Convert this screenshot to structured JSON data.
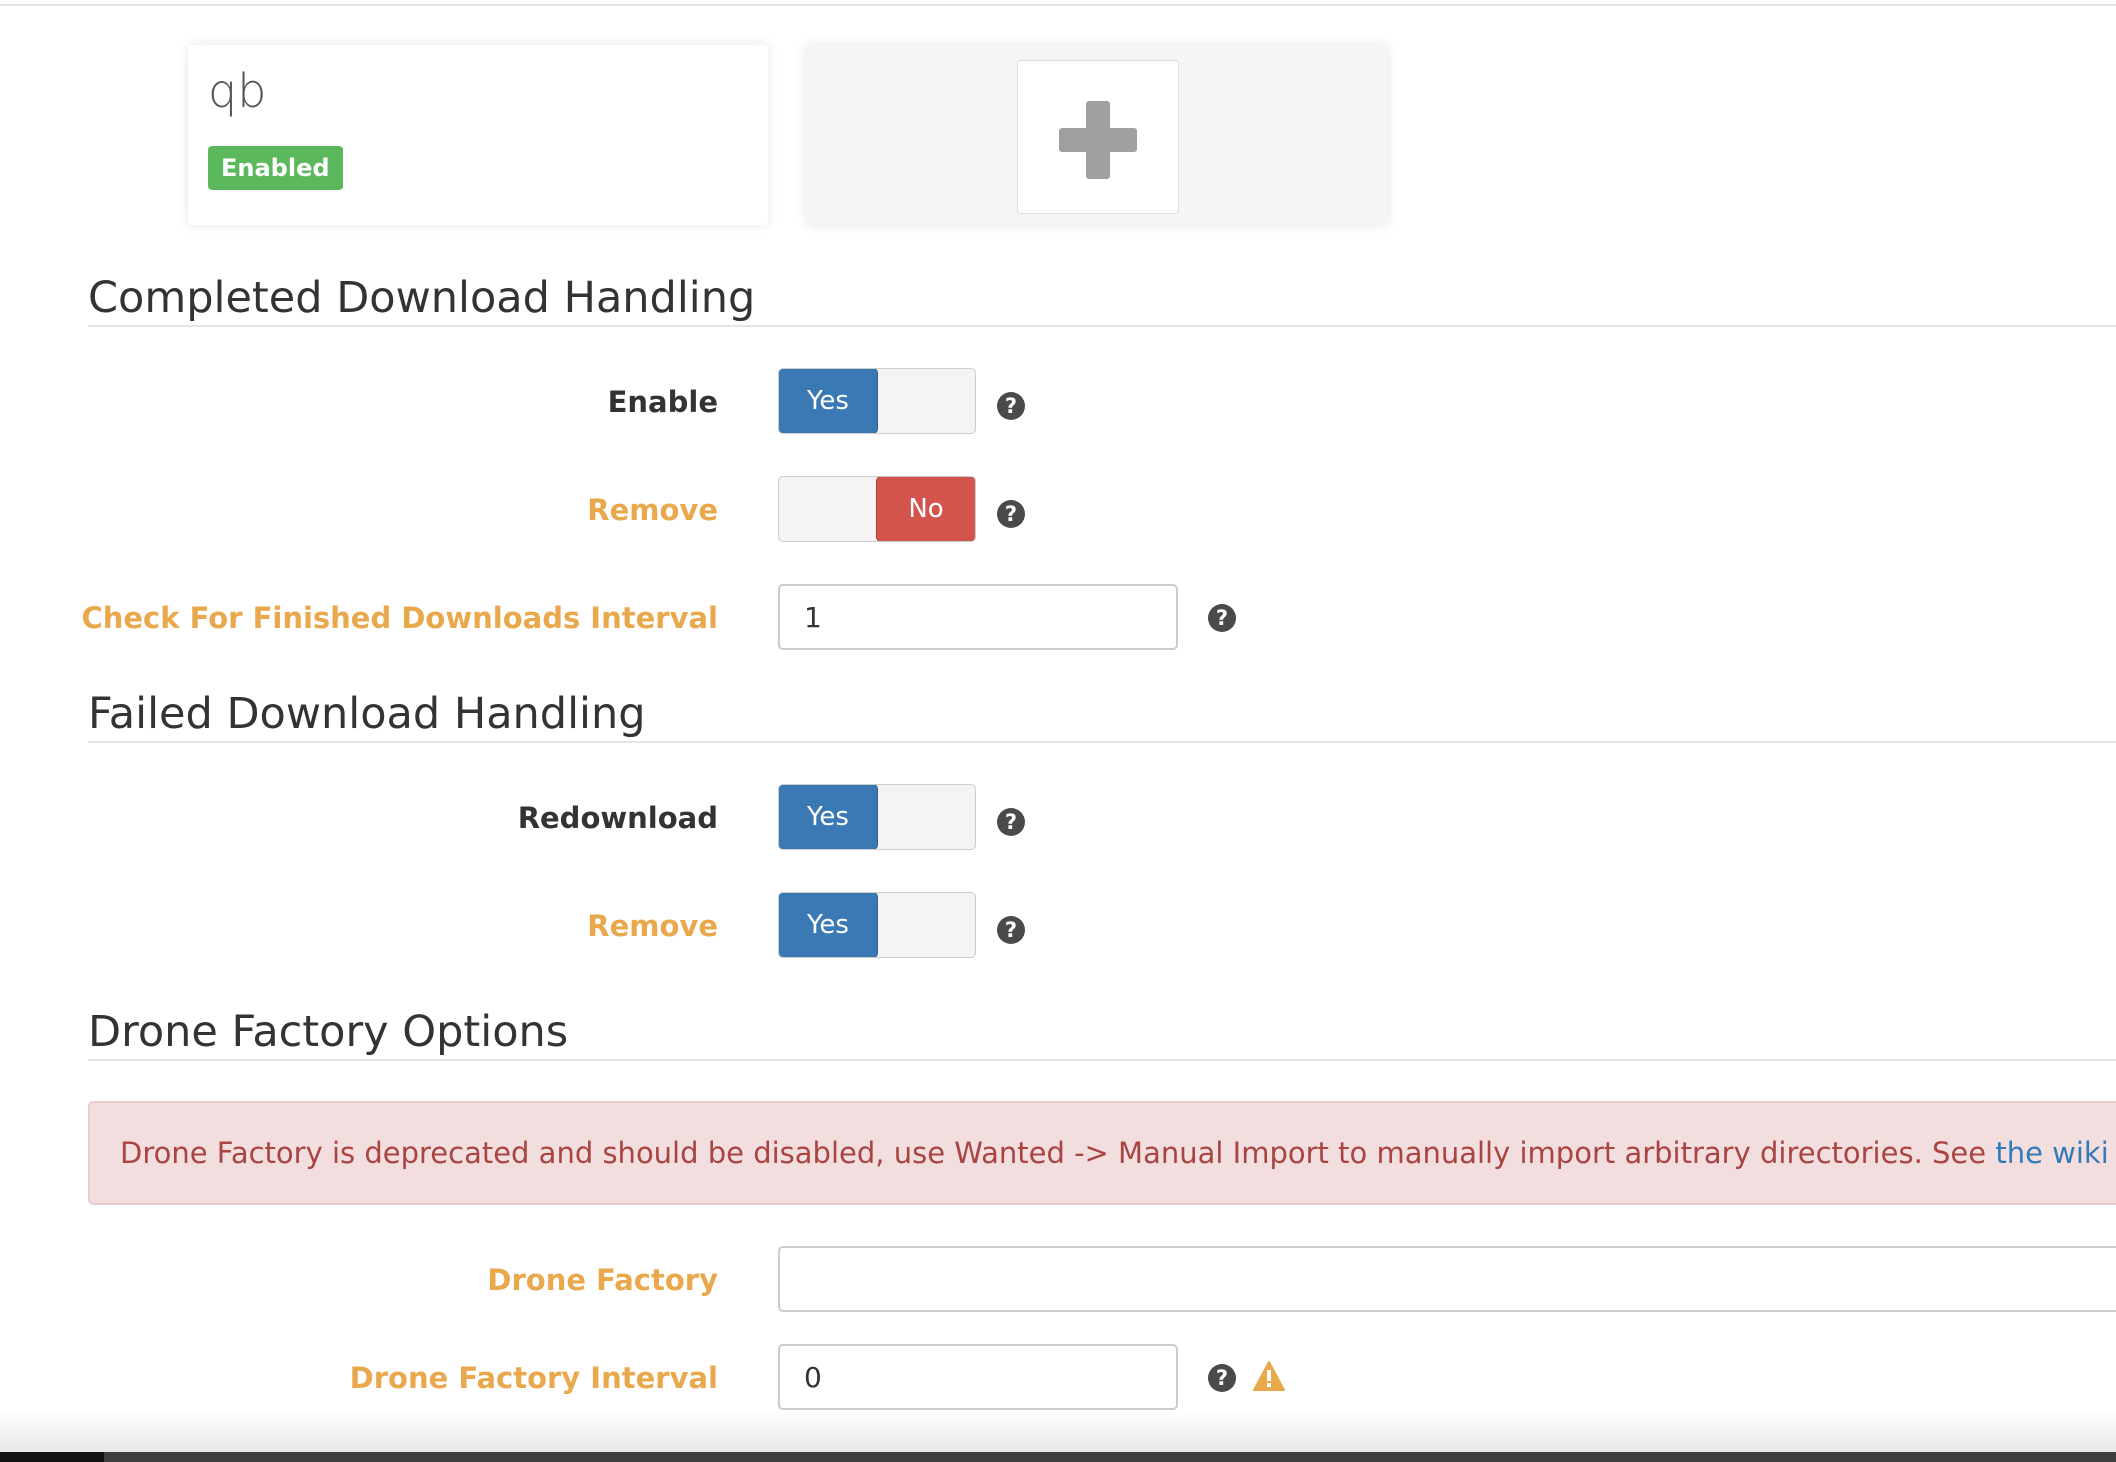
{
  "download_clients": {
    "client": {
      "name": "qb",
      "status": "Enabled"
    },
    "add_client_icon": "plus-icon"
  },
  "completed_download_handling": {
    "title": "Completed Download Handling",
    "enable": {
      "label": "Enable",
      "value": "Yes"
    },
    "remove": {
      "label": "Remove",
      "value": "No"
    },
    "check_interval": {
      "label": "Check For Finished Downloads Interval",
      "value": "1"
    }
  },
  "failed_download_handling": {
    "title": "Failed Download Handling",
    "redownload": {
      "label": "Redownload",
      "value": "Yes"
    },
    "remove": {
      "label": "Remove",
      "value": "Yes"
    }
  },
  "drone_factory_options": {
    "title": "Drone Factory Options",
    "alert": {
      "text": "Drone Factory is deprecated and should be disabled, use Wanted -> Manual Import to manually import arbitrary directories. See ",
      "link_text": "the wiki for further details"
    },
    "drone_factory": {
      "label": "Drone Factory",
      "value": ""
    },
    "drone_factory_interval": {
      "label": "Drone Factory Interval",
      "value": "0"
    }
  },
  "help_glyph": "?",
  "colors": {
    "primary_blue": "#3b79b5",
    "danger_red": "#d2544c",
    "success_green": "#5cb85c",
    "advanced_orange": "#eaa84d",
    "alert_bg": "#f2dede",
    "alert_text": "#a94442",
    "link_blue": "#337ab7"
  }
}
